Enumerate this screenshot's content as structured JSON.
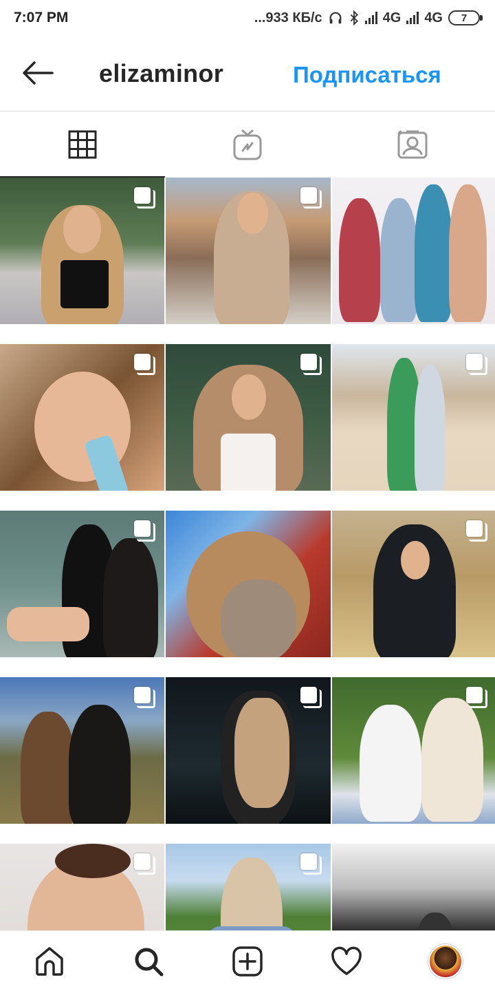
{
  "status_bar": {
    "time": "7:07 PM",
    "speed": "...933 КБ/с",
    "network1": "4G",
    "network2": "4G",
    "battery": "7"
  },
  "header": {
    "username": "elizaminor",
    "follow_label": "Подписаться",
    "accent_color": "#1a95f6"
  },
  "tabs": [
    {
      "name": "grid-icon",
      "active": true
    },
    {
      "name": "igtv-icon",
      "active": false
    },
    {
      "name": "tagged-icon",
      "active": false
    }
  ],
  "posts": [
    {
      "multi": true
    },
    {
      "multi": true
    },
    {
      "multi": false
    },
    {
      "multi": true
    },
    {
      "multi": true
    },
    {
      "multi": true
    },
    {
      "multi": true
    },
    {
      "multi": false
    },
    {
      "multi": true
    },
    {
      "multi": true
    },
    {
      "multi": true
    },
    {
      "multi": true
    },
    {
      "multi": true
    },
    {
      "multi": true
    },
    {
      "multi": false
    }
  ],
  "bottom_nav": [
    "home-icon",
    "search-icon",
    "new-post-icon",
    "activity-icon",
    "profile-avatar"
  ]
}
